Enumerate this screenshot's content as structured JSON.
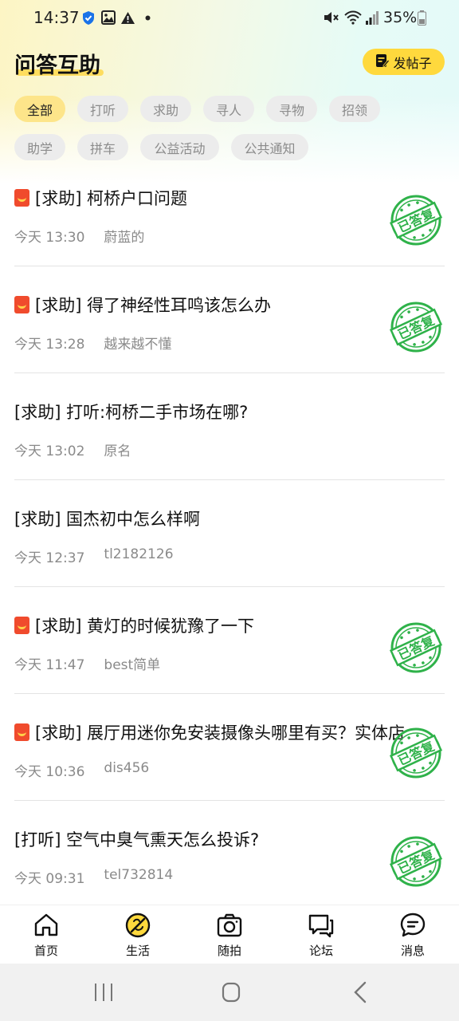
{
  "status_bar": {
    "time": "14:37",
    "battery": "35%",
    "icons": [
      "shield-check-icon",
      "image-icon",
      "warning-icon",
      "dot-icon",
      "mute-icon",
      "wifi-icon",
      "signal-icon",
      "battery-icon"
    ]
  },
  "header": {
    "title": "问答互助",
    "post_button_label": "发帖子",
    "post_button_icon": "edit-note-icon"
  },
  "filters": [
    {
      "label": "全部",
      "active": true
    },
    {
      "label": "打听",
      "active": false
    },
    {
      "label": "求助",
      "active": false
    },
    {
      "label": "寻人",
      "active": false
    },
    {
      "label": "寻物",
      "active": false
    },
    {
      "label": "招领",
      "active": false
    },
    {
      "label": "助学",
      "active": false
    },
    {
      "label": "拼车",
      "active": false
    },
    {
      "label": "公益活动",
      "active": false
    },
    {
      "label": "公共通知",
      "active": false
    }
  ],
  "posts": [
    {
      "title": "[求助] 柯桥户口问题",
      "time": "今天 13:30",
      "author": "蔚蓝的",
      "reward": true,
      "answered": true
    },
    {
      "title": "[求助] 得了神经性耳鸣该怎么办",
      "time": "今天 13:28",
      "author": "越来越不懂",
      "reward": true,
      "answered": true
    },
    {
      "title": "[求助] 打听:柯桥二手市场在哪?",
      "time": "今天 13:02",
      "author": "原名",
      "reward": false,
      "answered": false
    },
    {
      "title": "[求助] 国杰初中怎么样啊",
      "time": "今天 12:37",
      "author": "tl2182126",
      "reward": false,
      "answered": false
    },
    {
      "title": "[求助] 黄灯的时候犹豫了一下",
      "time": "今天 11:47",
      "author": "best简单",
      "reward": true,
      "answered": true
    },
    {
      "title": "[求助] 展厅用迷你免安装摄像头哪里有买？实体店",
      "time": "今天 10:36",
      "author": "dis456",
      "reward": true,
      "answered": true
    },
    {
      "title": "[打听] 空气中臭气熏天怎么投诉?",
      "time": "今天 09:31",
      "author": "tel732814",
      "reward": false,
      "answered": true
    }
  ],
  "stamp_text": "已答复",
  "bottom_nav": [
    {
      "label": "首页",
      "icon": "home-icon"
    },
    {
      "label": "生活",
      "icon": "life-icon"
    },
    {
      "label": "随拍",
      "icon": "camera-icon"
    },
    {
      "label": "论坛",
      "icon": "forum-icon"
    },
    {
      "label": "消息",
      "icon": "message-icon"
    }
  ],
  "colors": {
    "accent": "#ffd93d",
    "chip_active": "#fde58a",
    "chip": "#ececec",
    "stamp_green": "#2fb24a",
    "reward_red": "#f04b2d"
  }
}
